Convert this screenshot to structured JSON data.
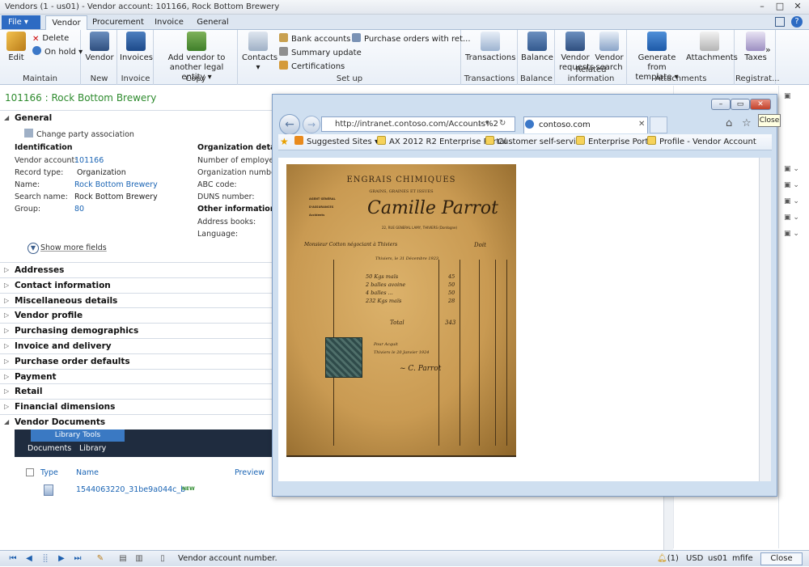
{
  "window": {
    "title": "Vendors (1 - us01) - Vendor account: 101166, Rock Bottom Brewery"
  },
  "menu": {
    "file": "File",
    "tabs": [
      "Vendor",
      "Procurement",
      "Invoice",
      "General"
    ]
  },
  "ribbon": {
    "maintain": {
      "edit": "Edit",
      "delete": "Delete",
      "onhold": "On hold",
      "label": "Maintain"
    },
    "new": {
      "vendor": "Vendor",
      "label": "New"
    },
    "invoice": {
      "invoices": "Invoices",
      "label": "Invoice"
    },
    "copy": {
      "add_vendor": "Add vendor to",
      "other_entity": "another legal entity",
      "label": "Copy"
    },
    "setup": {
      "contacts": "Contacts",
      "bank": "Bank accounts",
      "summary": "Summary update",
      "certifications": "Certifications",
      "purchase_orders": "Purchase orders with ret...",
      "label": "Set up"
    },
    "transactions": {
      "btn": "Transactions",
      "label": "Transactions"
    },
    "balance": {
      "btn": "Balance",
      "label": "Balance"
    },
    "related": {
      "vendor_requests_1": "Vendor",
      "vendor_requests_2": "requests",
      "vendor_search_1": "Vendor",
      "vendor_search_2": "search",
      "label": "Related information"
    },
    "attachments": {
      "generate_1": "Generate from",
      "generate_2": "template",
      "attachments": "Attachments",
      "label": "Attachments"
    },
    "registration": {
      "taxes": "Taxes",
      "label": "Registrat..."
    }
  },
  "record": {
    "title": "101166 : Rock Bottom Brewery"
  },
  "general": {
    "header": "General",
    "change_party": "Change party association",
    "identification": "Identification",
    "labels": [
      "Vendor account:",
      "Record type:",
      "Name:",
      "Search name:",
      "Group:"
    ],
    "values": [
      "101166",
      "Organization",
      "Rock Bottom Brewery",
      "Rock Bottom Brewery",
      "80"
    ],
    "org_details": "Organization details",
    "org_labels": [
      "Number of employees",
      "Organization number:",
      "ABC code:",
      "DUNS number:"
    ],
    "other_info": "Other information",
    "other_labels": [
      "Address books:",
      "Language:"
    ],
    "show_more": "Show more fields"
  },
  "sections": [
    "Addresses",
    "Contact information",
    "Miscellaneous details",
    "Vendor profile",
    "Purchasing demographics",
    "Invoice and delivery",
    "Purchase order defaults",
    "Payment",
    "Retail",
    "Financial dimensions",
    "Vendor Documents"
  ],
  "docs": {
    "library_tools": "Library Tools",
    "tab_documents": "Documents",
    "tab_library": "Library",
    "col_type": "Type",
    "col_name": "Name",
    "col_preview": "Preview",
    "file": "1544063220_31be9a044c_b",
    "new_badge": "NEW"
  },
  "browser": {
    "address": "http://intranet.contoso.com/Accounts%2",
    "tab": "contoso.com",
    "favorites": [
      "Suggested Sites",
      "AX 2012 R2 Enterprise Portal",
      "Customer self-service",
      "Enterprise Portal",
      "Profile - Vendor Account"
    ],
    "tooltip": "Close"
  },
  "invoice_image": {
    "heading": "ENGRAIS CHIMIQUES",
    "subheading": "GRAINS, GRAINES ET ISSUES",
    "signature": "Camille Parrot",
    "left_block": [
      "AGENT GÉNÉRAL",
      "D'ASSURANCES",
      "Accidents"
    ],
    "address": "22, RUE GENERAL LAMY, THIVIERS (Dordogne)",
    "doit": "Doit",
    "monsieur": "Monsieur Cotton négociant à Thiviers",
    "date": "Thiviers, le 31 Décembre 1923",
    "lines": [
      "50 Kgs maïs",
      "2 balles avoine",
      "4 balles ...",
      "232 Kgs maïs"
    ],
    "amounts": [
      "45",
      "50",
      "50",
      "28"
    ],
    "total_label": "Total",
    "total": "343",
    "note_1": "Pour Acquit",
    "note_2": "Thiviers le 20 Janvier 1924"
  },
  "status": {
    "message": "Vendor account number.",
    "alerts": "(1)",
    "currency": "USD",
    "company": "us01",
    "user": "mfife",
    "close": "Close"
  },
  "colors": {
    "accent": "#2d6bc3",
    "record_title": "#2e8b2e",
    "link": "#1a64b4",
    "paper": "#c99a52"
  }
}
